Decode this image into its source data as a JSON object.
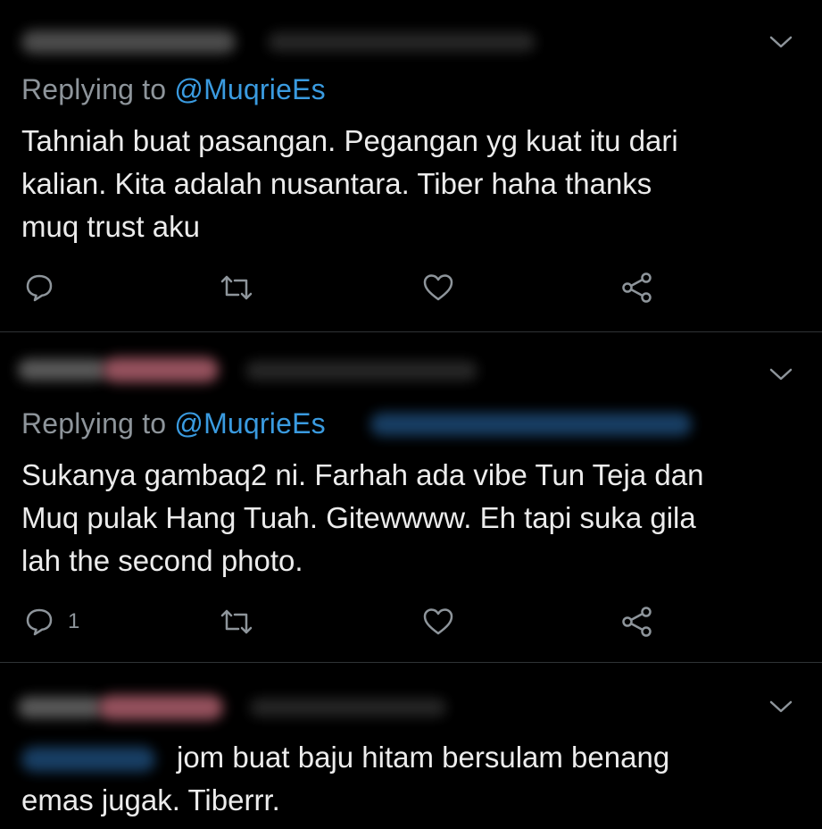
{
  "tweets": [
    {
      "reply_prefix": "Replying to ",
      "reply_handle": "@MuqrieEs",
      "text": "Tahniah buat pasangan. Pegangan yg kuat itu dari\nkalian. Kita adalah nusantara. Tiber haha thanks\nmuq trust aku",
      "reply_count": ""
    },
    {
      "reply_prefix": "Replying to ",
      "reply_handle": "@MuqrieEs",
      "text": "Sukanya gambaq2 ni. Farhah ada vibe Tun Teja dan\nMuq pulak Hang Tuah. Gitewwww. Eh tapi suka gila\nlah the second photo.",
      "reply_count": "1"
    },
    {
      "text_line1": "jom buat baju hitam bersulam benang",
      "text_line2": "emas jugak. Tiberrr."
    }
  ],
  "colors": {
    "background": "#000000",
    "text": "#ececec",
    "muted": "#8e959b",
    "accent": "#3a9be0",
    "divider": "#2f3336"
  },
  "icons": [
    "reply-icon",
    "retweet-icon",
    "like-icon",
    "share-icon",
    "chevron-down-icon"
  ]
}
